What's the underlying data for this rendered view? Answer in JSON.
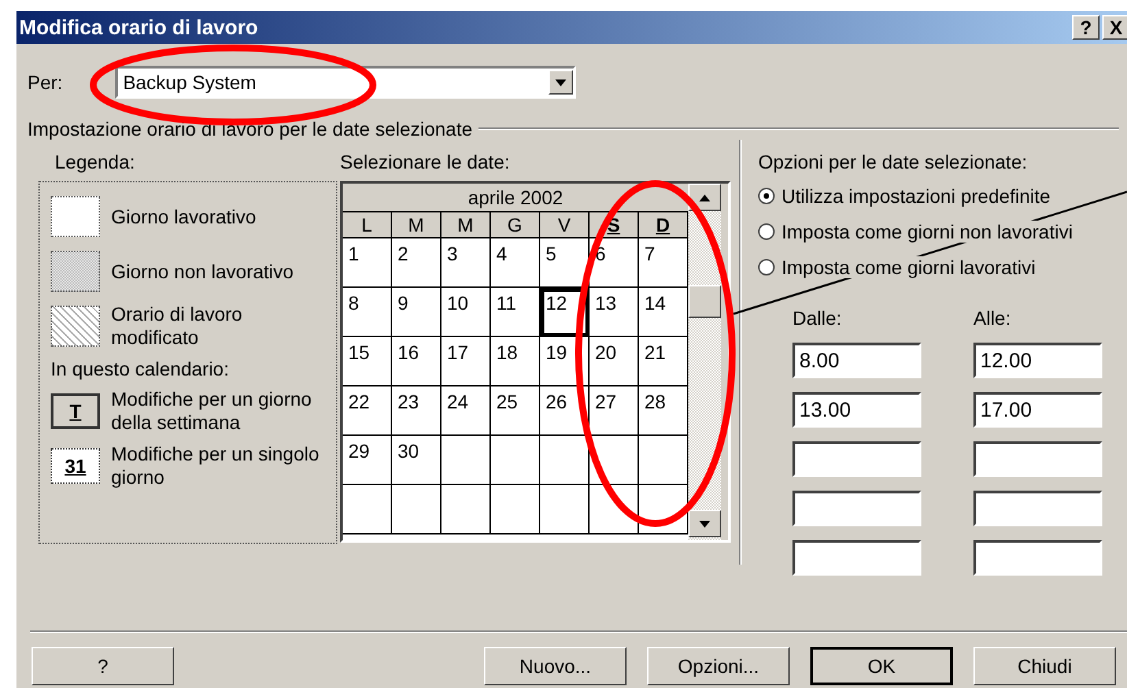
{
  "window": {
    "title": "Modifica orario di lavoro",
    "controls": [
      "?",
      "X"
    ]
  },
  "for_field": {
    "label": "Per:",
    "value": "Backup System"
  },
  "group_title": "Impostazione orario di lavoro per le date selezionate",
  "legend": {
    "title": "Legenda:",
    "items": [
      {
        "kind": "working",
        "label": "Giorno lavorativo"
      },
      {
        "kind": "nonworking",
        "label": "Giorno non lavorativo"
      },
      {
        "kind": "modified",
        "label": "Orario di lavoro modificato"
      }
    ],
    "subtitle": "In questo calendario:",
    "calendar_items": [
      {
        "kind": "weekday",
        "glyph": "T",
        "label": "Modifiche per un giorno della settimana"
      },
      {
        "kind": "single",
        "glyph": "31",
        "label": "Modifiche per un singolo giorno"
      }
    ]
  },
  "calendar": {
    "label": "Selezionare le date:",
    "month": "aprile 2002",
    "weekdays": [
      {
        "label": "L",
        "bold": false
      },
      {
        "label": "M",
        "bold": false
      },
      {
        "label": "M",
        "bold": false
      },
      {
        "label": "G",
        "bold": false
      },
      {
        "label": "V",
        "bold": false
      },
      {
        "label": "S",
        "bold": true
      },
      {
        "label": "D",
        "bold": true
      }
    ],
    "weeks": [
      [
        {
          "day": "1",
          "selected": false
        },
        {
          "day": "2",
          "selected": false
        },
        {
          "day": "3",
          "selected": false
        },
        {
          "day": "4",
          "selected": false
        },
        {
          "day": "5",
          "selected": false
        },
        {
          "day": "6",
          "selected": false
        },
        {
          "day": "7",
          "selected": false
        }
      ],
      [
        {
          "day": "8",
          "selected": false
        },
        {
          "day": "9",
          "selected": false
        },
        {
          "day": "10",
          "selected": false
        },
        {
          "day": "11",
          "selected": false
        },
        {
          "day": "12",
          "selected": true
        },
        {
          "day": "13",
          "selected": false
        },
        {
          "day": "14",
          "selected": false
        }
      ],
      [
        {
          "day": "15",
          "selected": false
        },
        {
          "day": "16",
          "selected": false
        },
        {
          "day": "17",
          "selected": false
        },
        {
          "day": "18",
          "selected": false
        },
        {
          "day": "19",
          "selected": false
        },
        {
          "day": "20",
          "selected": false
        },
        {
          "day": "21",
          "selected": false
        }
      ],
      [
        {
          "day": "22",
          "selected": false
        },
        {
          "day": "23",
          "selected": false
        },
        {
          "day": "24",
          "selected": false
        },
        {
          "day": "25",
          "selected": false
        },
        {
          "day": "26",
          "selected": false
        },
        {
          "day": "27",
          "selected": false
        },
        {
          "day": "28",
          "selected": false
        }
      ],
      [
        {
          "day": "29",
          "selected": false
        },
        {
          "day": "30",
          "selected": false
        },
        {
          "selected": false
        },
        {
          "selected": false
        },
        {
          "selected": false
        },
        {
          "selected": false
        },
        {
          "selected": false
        }
      ],
      [
        {
          "selected": false
        },
        {
          "selected": false
        },
        {
          "selected": false
        },
        {
          "selected": false
        },
        {
          "selected": false
        },
        {
          "selected": false
        },
        {
          "selected": false
        }
      ]
    ]
  },
  "options": {
    "title": "Opzioni per le date selezionate:",
    "radios": [
      {
        "label": "Utilizza impostazioni predefinite",
        "selected": true
      },
      {
        "label": "Imposta come giorni non lavorativi",
        "selected": false
      },
      {
        "label": "Imposta come giorni lavorativi",
        "selected": false
      }
    ],
    "from_label": "Dalle:",
    "to_label": "Alle:",
    "time_rows": [
      {
        "from": "8.00",
        "to": "12.00"
      },
      {
        "from": "13.00",
        "to": "17.00"
      },
      {},
      {},
      {}
    ]
  },
  "buttons": [
    "?",
    "Nuovo...",
    "Opzioni...",
    "OK",
    "Chiudi"
  ],
  "annotations": [
    {
      "kind": "ellipse"
    },
    {
      "kind": "ellipse"
    },
    {
      "kind": "leader"
    }
  ]
}
